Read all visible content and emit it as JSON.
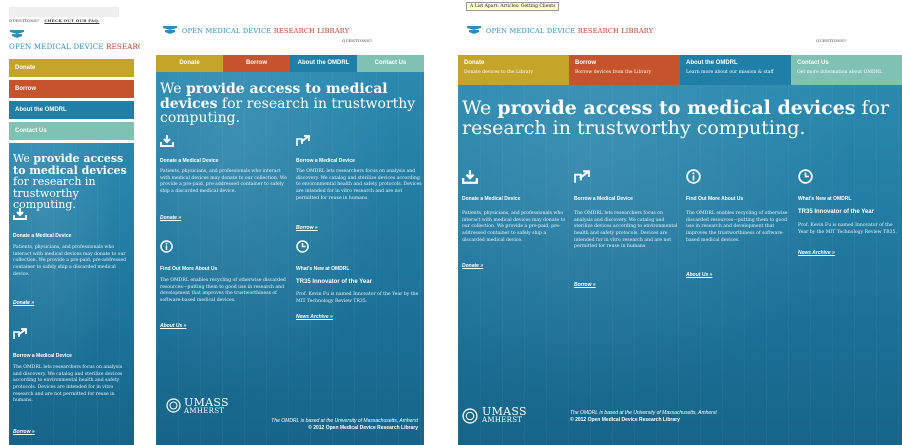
{
  "header": {
    "questions_label": "QUESTIONS?",
    "faq_link": "CHECK OUT OUR FAQ.",
    "logo_open": "OPEN ",
    "logo_medical": "MEDICAL DEVICE ",
    "logo_research": "RESEARCH LIBRARY"
  },
  "nav": {
    "donate": "Donate",
    "borrow": "Borrow",
    "about": "About the OMDRL",
    "contact": "Contact Us",
    "donate_sub": "Donate devices to the Library",
    "borrow_sub": "Borrow devices from the Library",
    "about_sub": "Learn more about our mission & staff",
    "contact_sub": "Get more information about OMDRL"
  },
  "hero": {
    "we": "We ",
    "bold": "provide access to medical devices",
    "rest": " for research in trustworthy computing."
  },
  "sections": {
    "donate_title": "Donate a Medical Device",
    "donate_body": "Patients, physicians, and professionals who interact with medical devices may donate to our collection. We provide a pre-paid, pre-addressed container to safely ship a discarded medical device.",
    "donate_link": "Donate »",
    "borrow_title": "Borrow a Medical Device",
    "borrow_body": "The OMDRL lets researchers focus on analysis and discovery. We catalog and sterilize devices according to environmental health and safety protocols. Devices are intended for in vitro research and are not permitted for reuse in humans.",
    "borrow_link": "Borrow »",
    "about_title": "Find Out More About Us",
    "about_body": "The OMDRL enables recycling of otherwise discarded resources—putting them to good use in research and development that improves the trustworthiness of software-based medical devices.",
    "about_link": "About Us »",
    "news_title": "What's New at OMDRL",
    "news_head": "TR35 Innovator of the Year",
    "news_body": "Prof. Kevin Fu is named Innovator of the Year by the MIT Technology Review TR35.",
    "news_link": "News Archive »"
  },
  "footer": {
    "umass_1": "UMASS",
    "umass_2": "AMHERST",
    "based": "The OMDRL is based at the University of Massachusetts, Amherst",
    "copyright": "© 2012 Open Medical Device Research Library"
  },
  "tooltip": "A List Apart: Articles: Getting Clients",
  "colors": {
    "donate": "#c4a52a",
    "borrow": "#c5532c",
    "about": "#1f7fa6",
    "contact": "#7fc1b2",
    "background": "#1f7fa6"
  }
}
